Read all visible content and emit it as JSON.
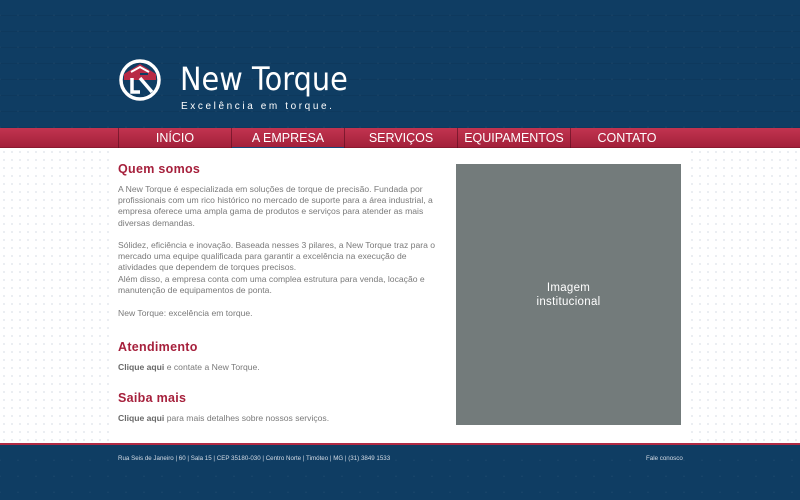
{
  "brand": {
    "name": "New Torque",
    "tagline": "Excelência em torque.",
    "colors": {
      "primary": "#0f3d63",
      "accent": "#a6203c"
    }
  },
  "nav": {
    "items": [
      {
        "label": "INÍCIO"
      },
      {
        "label": "A EMPRESA"
      },
      {
        "label": "SERVIÇOS"
      },
      {
        "label": "EQUIPAMENTOS"
      },
      {
        "label": "CONTATO"
      }
    ],
    "active_index": 1
  },
  "about": {
    "title": "Quem somos",
    "p1": "A New Torque é especializada em soluções de torque de precisão. Fundada por profissionais com um rico histórico no mercado de suporte para a área industrial, a empresa oferece uma ampla gama de produtos e serviços para atender as mais diversas demandas.",
    "p2a": "Sólidez, eficiência e inovação. Baseada nesses 3 pilares, a New Torque traz para o mercado uma equipe qualificada para garantir a excelência na execução de atividades que dependem de torques precisos.",
    "p2b": "Além disso, a empresa conta com uma complea estrutura para venda, locação e manutenção de equipamentos de ponta.",
    "p3": "New Torque: excelência em torque."
  },
  "atendimento": {
    "title": "Atendimento",
    "link": "Clique aqui",
    "rest": " e contate a New Torque."
  },
  "saiba": {
    "title": "Saiba mais",
    "link": "Clique aqui",
    "rest": " para mais detalhes sobre nossos serviços."
  },
  "image_placeholder": {
    "line1": "Imagem",
    "line2": "institucional"
  },
  "footer": {
    "address": "Rua Seis de Janeiro  |  60  |  Sala 15  |  CEP 35180-030  |  Centro Norte  |  Timóteo  |  MG  |  (31) 3849 1533",
    "contact_link": "Fale conosco"
  },
  "icons": {
    "logo": "new-torque-logo-icon"
  }
}
